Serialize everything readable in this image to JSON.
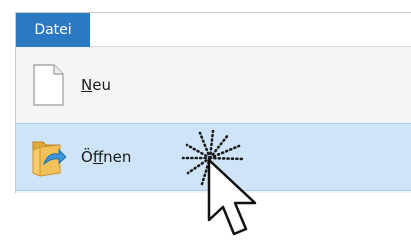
{
  "ribbon": {
    "file_tab_label": "Datei"
  },
  "file_menu": {
    "items": [
      {
        "label": "Neu",
        "access_key": "N",
        "label_rest": "eu",
        "icon": "blank-document-icon",
        "state": "normal"
      },
      {
        "label": "Öffnen",
        "label_prefix": "Ö",
        "access_key": "f",
        "label_rest": "fnen",
        "icon": "open-folder-icon",
        "state": "hover"
      }
    ]
  },
  "pointer": {
    "icon": "arrow-cursor-icon",
    "effect": "click-burst-icon"
  },
  "colors": {
    "file_tab_bg": "#2b79c2",
    "menu_bg": "#f5f5f5",
    "hover_bg": "#cfe4f8",
    "hover_border": "#a9cbed"
  }
}
